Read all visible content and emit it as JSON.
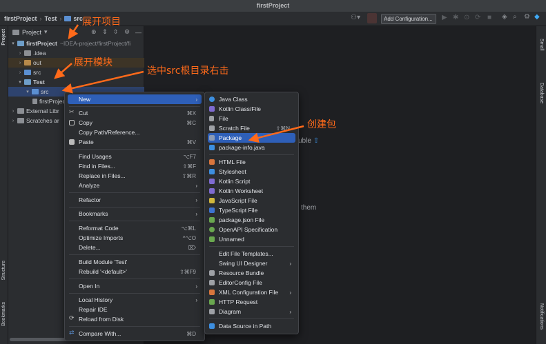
{
  "window": {
    "title": "firstProject"
  },
  "navbar": {
    "crumbs": [
      "firstProject",
      "Test",
      "src"
    ],
    "run_config": "Add Configuration..."
  },
  "left_stripe": {
    "project": "Project",
    "structure": "Structure",
    "bookmarks": "Bookmarks"
  },
  "right_stripe": {
    "small": "Small",
    "database": "Database",
    "notifications": "Notifications"
  },
  "project_panel": {
    "title": "Project",
    "tree": [
      {
        "label": "firstProject",
        "extra": "~IDEA-project/firstProject/fi"
      },
      {
        "label": ".idea"
      },
      {
        "label": "out"
      },
      {
        "label": "src"
      },
      {
        "label": "Test"
      },
      {
        "label": "src"
      },
      {
        "label": "firstProjec"
      },
      {
        "label": "External Libr"
      },
      {
        "label": "Scratches ar"
      }
    ]
  },
  "editor": {
    "hint1": "uble",
    "hint2": "them"
  },
  "context_menu": {
    "items": [
      {
        "label": "New",
        "shortcut": ""
      },
      {
        "label": "Cut",
        "shortcut": "⌘X"
      },
      {
        "label": "Copy",
        "shortcut": "⌘C"
      },
      {
        "label": "Copy Path/Reference...",
        "shortcut": ""
      },
      {
        "label": "Paste",
        "shortcut": "⌘V"
      },
      {
        "label": "Find Usages",
        "shortcut": "⌥F7"
      },
      {
        "label": "Find in Files...",
        "shortcut": "⇧⌘F"
      },
      {
        "label": "Replace in Files...",
        "shortcut": "⇧⌘R"
      },
      {
        "label": "Analyze",
        "shortcut": ""
      },
      {
        "label": "Refactor",
        "shortcut": ""
      },
      {
        "label": "Bookmarks",
        "shortcut": ""
      },
      {
        "label": "Reformat Code",
        "shortcut": "⌥⌘L"
      },
      {
        "label": "Optimize Imports",
        "shortcut": "^⌥O"
      },
      {
        "label": "Delete...",
        "shortcut": "⌦"
      },
      {
        "label": "Build Module 'Test'",
        "shortcut": ""
      },
      {
        "label": "Rebuild '<default>'",
        "shortcut": "⇧⌘F9"
      },
      {
        "label": "Open In",
        "shortcut": ""
      },
      {
        "label": "Local History",
        "shortcut": ""
      },
      {
        "label": "Repair IDE",
        "shortcut": ""
      },
      {
        "label": "Reload from Disk",
        "shortcut": ""
      },
      {
        "label": "Compare With...",
        "shortcut": "⌘D"
      }
    ]
  },
  "submenu": {
    "items": [
      {
        "label": "Java Class",
        "shortcut": ""
      },
      {
        "label": "Kotlin Class/File",
        "shortcut": ""
      },
      {
        "label": "File",
        "shortcut": ""
      },
      {
        "label": "Scratch File",
        "shortcut": "⇧⌘N"
      },
      {
        "label": "Package",
        "shortcut": ""
      },
      {
        "label": "package-info.java",
        "shortcut": ""
      },
      {
        "label": "HTML File",
        "shortcut": ""
      },
      {
        "label": "Stylesheet",
        "shortcut": ""
      },
      {
        "label": "Kotlin Script",
        "shortcut": ""
      },
      {
        "label": "Kotlin Worksheet",
        "shortcut": ""
      },
      {
        "label": "JavaScript File",
        "shortcut": ""
      },
      {
        "label": "TypeScript File",
        "shortcut": ""
      },
      {
        "label": "package.json File",
        "shortcut": ""
      },
      {
        "label": "OpenAPI Specification",
        "shortcut": ""
      },
      {
        "label": "Unnamed",
        "shortcut": ""
      },
      {
        "label": "Edit File Templates...",
        "shortcut": ""
      },
      {
        "label": "Swing UI Designer",
        "shortcut": ""
      },
      {
        "label": "Resource Bundle",
        "shortcut": ""
      },
      {
        "label": "EditorConfig File",
        "shortcut": ""
      },
      {
        "label": "XML Configuration File",
        "shortcut": ""
      },
      {
        "label": "HTTP Request",
        "shortcut": ""
      },
      {
        "label": "Diagram",
        "shortcut": ""
      },
      {
        "label": "Data Source in Path",
        "shortcut": ""
      }
    ]
  },
  "annotations": {
    "expand_project": "展开项目",
    "expand_module": "展开模块",
    "select_src": "选中src根目录右击",
    "create_package": "创建包"
  },
  "colors": {
    "accent": "#2e5fb8",
    "annotation": "#ff6a1a"
  }
}
